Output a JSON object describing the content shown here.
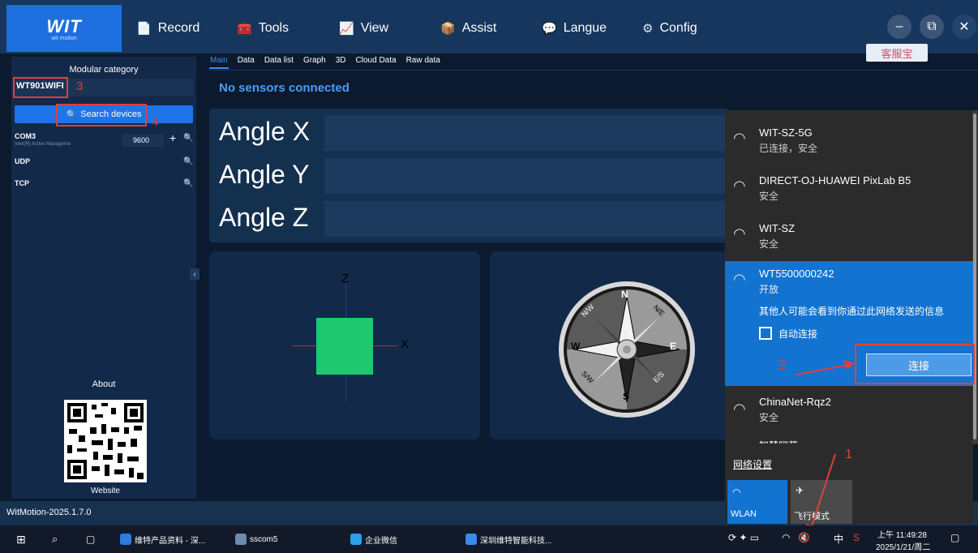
{
  "app": {
    "logo_main": "WIT",
    "logo_sub": "wit motion",
    "version": "WitMotion-2025.1.7.0",
    "kefu": "客服宝"
  },
  "nav": [
    {
      "label": "Record",
      "icon": "📄"
    },
    {
      "label": "Tools",
      "icon": "🧰"
    },
    {
      "label": "View",
      "icon": "📈"
    },
    {
      "label": "Assist",
      "icon": "📦"
    },
    {
      "label": "Langue",
      "icon": "💬"
    },
    {
      "label": "Config",
      "icon": "⚙"
    }
  ],
  "window": {
    "minimize": "–",
    "restore": "⧉",
    "close": "✕"
  },
  "sidebar": {
    "title": "Modular category",
    "device": "WT901WIFI",
    "search": "Search devices",
    "ports": [
      {
        "name": "COM3",
        "sub": "Intel(R) Active Manageme",
        "baud": "9600"
      },
      {
        "name": "UDP"
      },
      {
        "name": "TCP"
      }
    ],
    "about": "About",
    "website": "Website"
  },
  "tabs": [
    "Main",
    "Data",
    "Data list",
    "Graph",
    "3D",
    "Cloud Data",
    "Raw data"
  ],
  "status": "No sensors connected",
  "angles": [
    "Angle X",
    "Angle Y",
    "Angle Z"
  ],
  "axes": {
    "z": "Z",
    "x": "X"
  },
  "compass": {
    "n": "N",
    "s": "S",
    "e": "E",
    "w": "W",
    "ne": "N/E",
    "nw": "N/W",
    "se": "E/S",
    "sw": "S/W"
  },
  "wifi": {
    "networks": [
      {
        "name": "WIT-SZ-5G",
        "status": "已连接，安全"
      },
      {
        "name": "DIRECT-OJ-HUAWEI PixLab B5",
        "status": "安全"
      },
      {
        "name": "WIT-SZ",
        "status": "安全"
      },
      {
        "name": "WT5500000242",
        "status": "开放",
        "warning": "其他人可能会看到你通过此网络发送的信息",
        "auto": "自动连接",
        "connect": "连接"
      },
      {
        "name": "ChinaNet-Rqz2",
        "status": "安全"
      },
      {
        "name": "智慧同荷"
      }
    ],
    "settings": "网络设置",
    "wlan": "WLAN",
    "airplane": "飞行模式"
  },
  "annotations": [
    "1",
    "2",
    "3",
    "4"
  ],
  "taskbar": {
    "items": [
      "维特产品资料 - 深...",
      "sscom5",
      "企业微信",
      "深圳维特智能科技..."
    ],
    "time": "上午 11:49:28",
    "date": "2025/1/21/周二",
    "ime": "中"
  }
}
